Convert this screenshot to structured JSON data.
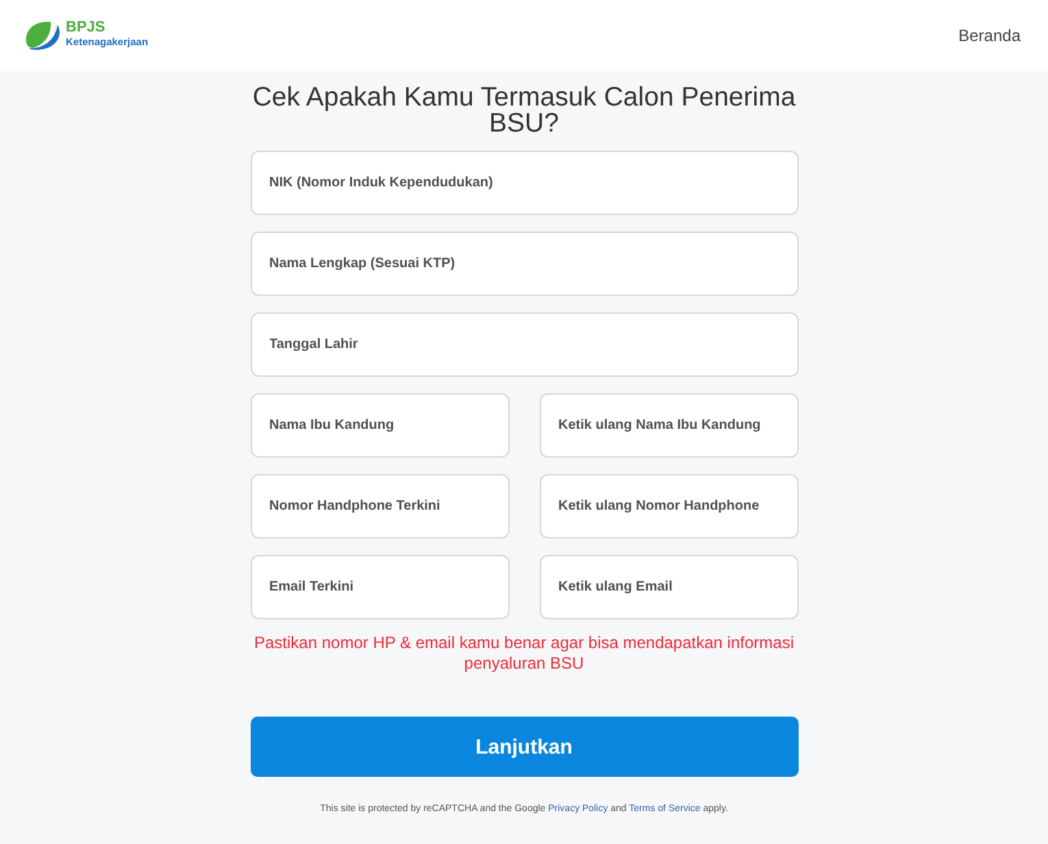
{
  "header": {
    "logo": {
      "name": "BPJS",
      "subtitle": "Ketenagakerjaan"
    },
    "nav": [
      {
        "label": "Beranda"
      }
    ]
  },
  "form": {
    "title": "Cek Apakah Kamu Termasuk Calon Penerima BSU?",
    "rows": [
      [
        {
          "placeholder": "NIK (Nomor Induk Kependudukan)"
        }
      ],
      [
        {
          "placeholder": "Nama Lengkap (Sesuai KTP)"
        }
      ],
      [
        {
          "placeholder": "Tanggal Lahir"
        }
      ],
      [
        {
          "placeholder": "Nama Ibu Kandung"
        },
        {
          "placeholder": "Ketik ulang Nama Ibu Kandung"
        }
      ],
      [
        {
          "placeholder": "Nomor Handphone Terkini"
        },
        {
          "placeholder": "Ketik ulang Nomor Handphone"
        }
      ],
      [
        {
          "placeholder": "Email Terkini"
        },
        {
          "placeholder": "Ketik ulang Email"
        }
      ]
    ],
    "note": "Pastikan nomor HP & email kamu benar agar bisa mendapatkan informasi penyaluran BSU",
    "submit": "Lanjutkan"
  },
  "footer": {
    "parts": [
      {
        "kind": "text",
        "text": "This site is protected by reCAPTCHA and the Google "
      },
      {
        "kind": "link",
        "text": "Privacy Policy"
      },
      {
        "kind": "text",
        "text": " and "
      },
      {
        "kind": "link",
        "text": "Terms of Service"
      },
      {
        "kind": "text",
        "text": " apply."
      }
    ]
  }
}
